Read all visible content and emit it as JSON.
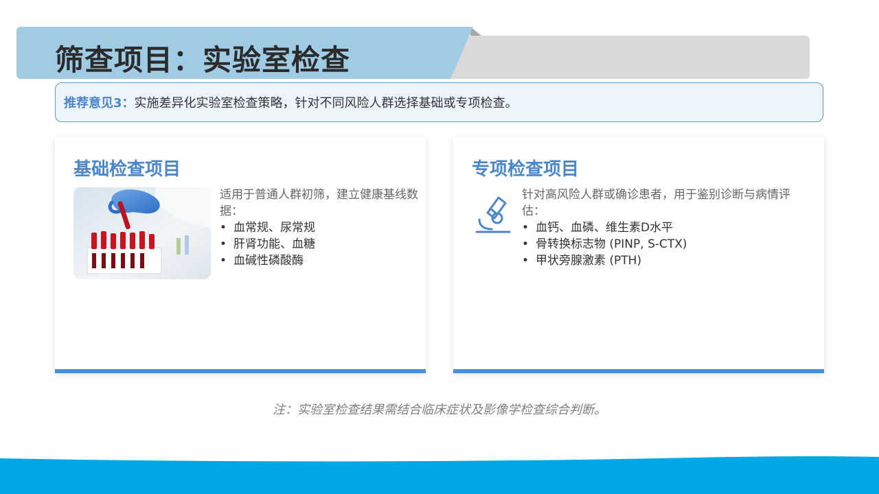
{
  "header": {
    "title": "筛查项目：实验室检查"
  },
  "recommendation": {
    "label": "推荐意见3：",
    "text": "实施差异化实验室检查策略，针对不同风险人群选择基础或专项检查。"
  },
  "cards": [
    {
      "title": "基础检查项目",
      "description": "适用于普通人群初筛，建立健康基线数据：",
      "items": [
        "血常规、尿常规",
        "肝肾功能、血糖",
        "血碱性磷酸酶"
      ],
      "visual": "blood-sample-photo"
    },
    {
      "title": "专项检查项目",
      "description": "针对高风险人群或确诊患者，用于鉴别诊断与病情评估：",
      "items": [
        "血钙、血磷、维生素D水平",
        "骨转换标志物 (PINP, S-CTX)",
        "甲状旁腺激素 (PTH)"
      ],
      "visual": "microscope-icon"
    }
  ],
  "footnote": "注：实验室检查结果需结合临床症状及影像学检查综合判断。",
  "colors": {
    "accent": "#4a86c8",
    "banner_blue": "#a0cbe4",
    "banner_gray": "#d9d9d9",
    "card_bar": "#4a8fd8",
    "wave": "#00a8e8"
  }
}
